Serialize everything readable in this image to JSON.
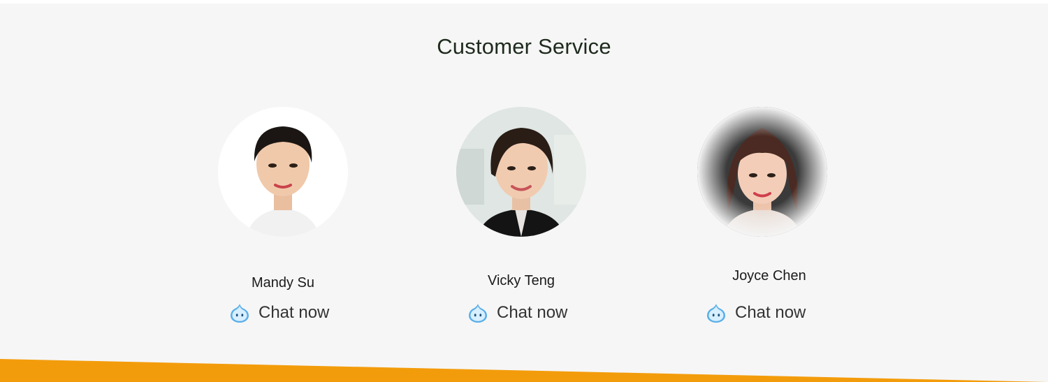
{
  "section": {
    "title": "Customer Service"
  },
  "agents": [
    {
      "name": "Mandy Su",
      "chat_label": "Chat now"
    },
    {
      "name": "Vicky Teng",
      "chat_label": "Chat now"
    },
    {
      "name": "Joyce Chen",
      "chat_label": "Chat now"
    }
  ],
  "colors": {
    "background": "#f6f6f6",
    "accent_band": "#f39c0b",
    "chat_icon": "#5aaee8"
  },
  "icons": {
    "chat": "chat-bubble-icon"
  }
}
